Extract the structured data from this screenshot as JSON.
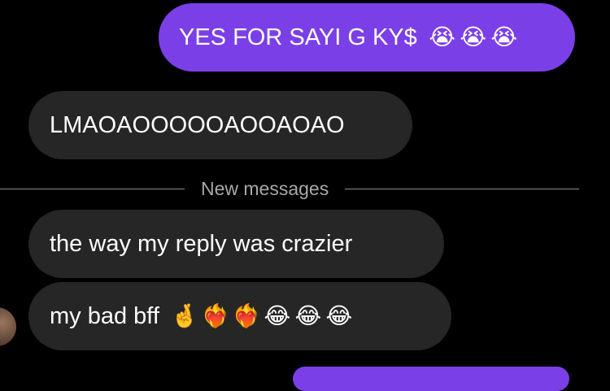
{
  "messages": [
    {
      "direction": "sent",
      "text": "YES FOR SAYI G KY$",
      "emojis": [
        "😭",
        "😭",
        "😭"
      ]
    },
    {
      "direction": "received",
      "text": "LMAOAOOOOOAOOAOAO",
      "emojis": []
    },
    {
      "direction": "received",
      "text": "the way my reply was crazier",
      "emojis": []
    },
    {
      "direction": "received",
      "text": "my bad bff",
      "emojis": [
        "🤞",
        "❤️‍🔥",
        "❤️‍🔥",
        "😂",
        "😂",
        "😂"
      ]
    }
  ],
  "divider": {
    "label": "New messages"
  },
  "colors": {
    "background": "#000000",
    "sent_bubble": "#7b3fe8",
    "received_bubble": "#262626",
    "divider_text": "#a8a8a8"
  }
}
